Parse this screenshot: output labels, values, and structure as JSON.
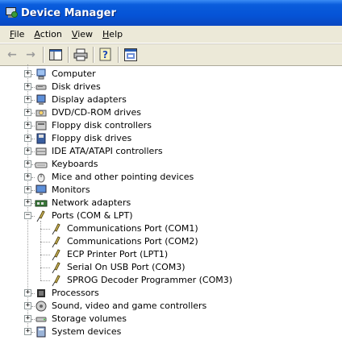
{
  "window": {
    "title": "Device Manager"
  },
  "menu": [
    {
      "label": "File",
      "mnemonic": "F",
      "rest": "ile"
    },
    {
      "label": "Action",
      "mnemonic": "A",
      "rest": "ction"
    },
    {
      "label": "View",
      "mnemonic": "V",
      "rest": "iew"
    },
    {
      "label": "Help",
      "mnemonic": "H",
      "rest": "elp"
    }
  ],
  "toolbar": {
    "buttons": [
      "back-icon",
      "forward-icon",
      "show-hide-tree-icon",
      "print-icon",
      "help-icon",
      "properties-icon"
    ]
  },
  "tree": {
    "categories": [
      {
        "label": "Computer",
        "icon": "computer-icon",
        "expanded": false
      },
      {
        "label": "Disk drives",
        "icon": "disk-drive-icon",
        "expanded": false
      },
      {
        "label": "Display adapters",
        "icon": "display-adapter-icon",
        "expanded": false
      },
      {
        "label": "DVD/CD-ROM drives",
        "icon": "cdrom-icon",
        "expanded": false
      },
      {
        "label": "Floppy disk controllers",
        "icon": "floppy-controller-icon",
        "expanded": false
      },
      {
        "label": "Floppy disk drives",
        "icon": "floppy-drive-icon",
        "expanded": false
      },
      {
        "label": "IDE ATA/ATAPI controllers",
        "icon": "ide-controller-icon",
        "expanded": false
      },
      {
        "label": "Keyboards",
        "icon": "keyboard-icon",
        "expanded": false
      },
      {
        "label": "Mice and other pointing devices",
        "icon": "mouse-icon",
        "expanded": false
      },
      {
        "label": "Monitors",
        "icon": "monitor-icon",
        "expanded": false
      },
      {
        "label": "Network adapters",
        "icon": "network-adapter-icon",
        "expanded": false
      },
      {
        "label": "Ports (COM & LPT)",
        "icon": "port-icon",
        "expanded": true,
        "children": [
          {
            "label": "Communications Port (COM1)",
            "icon": "port-icon"
          },
          {
            "label": "Communications Port (COM2)",
            "icon": "port-icon"
          },
          {
            "label": "ECP Printer Port (LPT1)",
            "icon": "port-icon"
          },
          {
            "label": "Serial On USB Port (COM3)",
            "icon": "port-icon"
          },
          {
            "label": "SPROG Decoder Programmer (COM3)",
            "icon": "port-icon"
          }
        ]
      },
      {
        "label": "Processors",
        "icon": "processor-icon",
        "expanded": false
      },
      {
        "label": "Sound, video and game controllers",
        "icon": "sound-icon",
        "expanded": false
      },
      {
        "label": "Storage volumes",
        "icon": "storage-volume-icon",
        "expanded": false
      },
      {
        "label": "System devices",
        "icon": "system-device-icon",
        "expanded": false
      }
    ]
  }
}
